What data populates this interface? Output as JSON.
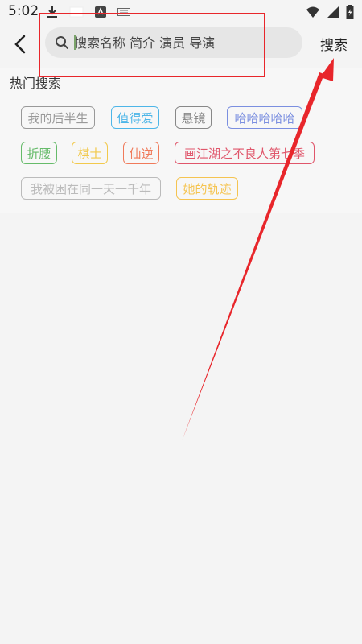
{
  "status_bar": {
    "time": "5:02"
  },
  "header": {
    "search_placeholder": "搜索名称 简介 演员 导演",
    "search_button_label": "搜索"
  },
  "hot": {
    "title": "热门搜索",
    "tags": [
      {
        "label": "我的后半生",
        "color": "#999999"
      },
      {
        "label": "值得爱",
        "color": "#4db6e8"
      },
      {
        "label": "悬镜",
        "color": "#888888"
      },
      {
        "label": "哈哈哈哈哈",
        "color": "#7b8fe0"
      },
      {
        "label": "折腰",
        "color": "#66bb6a"
      },
      {
        "label": "棋士",
        "color": "#f2c94c"
      },
      {
        "label": "仙逆",
        "color": "#f07a5a"
      },
      {
        "label": "画江湖之不良人第七季",
        "color": "#e0566b"
      },
      {
        "label": "我被困在同一天一千年",
        "color": "#bbbbbb"
      },
      {
        "label": "她的轨迹",
        "color": "#f5c451"
      }
    ]
  }
}
